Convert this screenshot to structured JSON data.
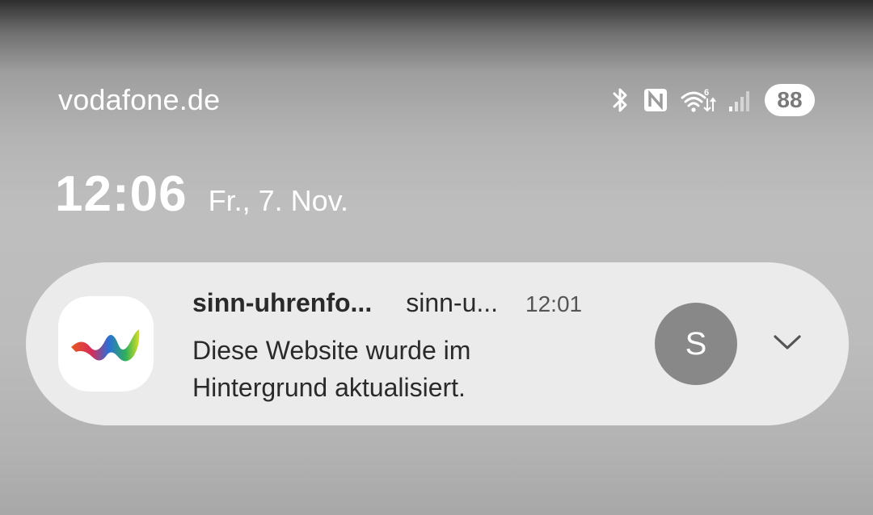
{
  "status_bar": {
    "carrier": "vodafone.de",
    "battery_level": "88",
    "icons": [
      "bluetooth-icon",
      "nfc-icon",
      "wifi-6-icon",
      "cellular-signal-icon",
      "battery-icon"
    ]
  },
  "lockscreen": {
    "time": "12:06",
    "date": "Fr., 7. Nov."
  },
  "notification": {
    "app_name": "sinn-uhrenfo...",
    "sub_name": "sinn-u...",
    "time": "12:01",
    "message": "Diese Website wurde im Hintergrund aktualisiert.",
    "avatar_letter": "S",
    "icons": [
      "app-logo-icon",
      "chevron-down-icon"
    ]
  },
  "colors": {
    "notification_bg": "#ebebeb",
    "avatar_bg": "#888888",
    "text": "#2a2a2a"
  }
}
